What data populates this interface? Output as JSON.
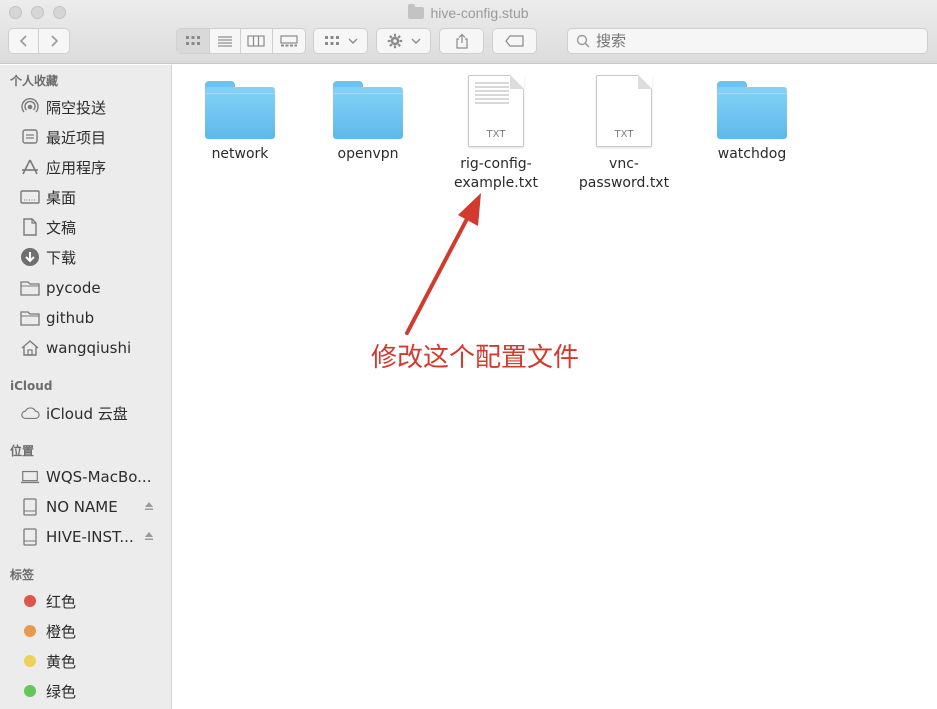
{
  "window": {
    "title": "hive-config.stub"
  },
  "toolbar": {
    "view_modes": [
      "icon-view",
      "list-view",
      "column-view",
      "gallery-view"
    ],
    "search_placeholder": "搜索"
  },
  "sidebar": {
    "favorites_header": "个人收藏",
    "favorites": [
      {
        "label": "隔空投送",
        "icon": "airdrop-icon"
      },
      {
        "label": "最近项目",
        "icon": "recents-icon"
      },
      {
        "label": "应用程序",
        "icon": "applications-icon"
      },
      {
        "label": "桌面",
        "icon": "desktop-icon"
      },
      {
        "label": "文稿",
        "icon": "documents-icon"
      },
      {
        "label": "下载",
        "icon": "downloads-icon"
      },
      {
        "label": "pycode",
        "icon": "folder-icon"
      },
      {
        "label": "github",
        "icon": "folder-icon"
      },
      {
        "label": "wangqiushi",
        "icon": "home-icon"
      }
    ],
    "icloud_header": "iCloud",
    "icloud": [
      {
        "label": "iCloud 云盘",
        "icon": "cloud-icon"
      }
    ],
    "locations_header": "位置",
    "locations": [
      {
        "label": "WQS-MacBo...",
        "icon": "laptop-icon"
      },
      {
        "label": "NO NAME",
        "icon": "drive-icon"
      },
      {
        "label": "HIVE-INST...",
        "icon": "drive-icon"
      }
    ],
    "tags_header": "标签",
    "tags": [
      {
        "label": "红色",
        "color": "#e0554b"
      },
      {
        "label": "橙色",
        "color": "#e89a4c"
      },
      {
        "label": "黄色",
        "color": "#eed05a"
      },
      {
        "label": "绿色",
        "color": "#62c65a"
      }
    ]
  },
  "files": [
    {
      "name": "network",
      "kind": "folder"
    },
    {
      "name": "openvpn",
      "kind": "folder"
    },
    {
      "name": "rig-config-example.txt",
      "kind": "txt",
      "badge": "TXT"
    },
    {
      "name": "vnc-password.txt",
      "kind": "txt",
      "badge": "TXT"
    },
    {
      "name": "watchdog",
      "kind": "folder"
    }
  ],
  "annotation": {
    "text": "修改这个配置文件",
    "color": "#d23a2d"
  }
}
